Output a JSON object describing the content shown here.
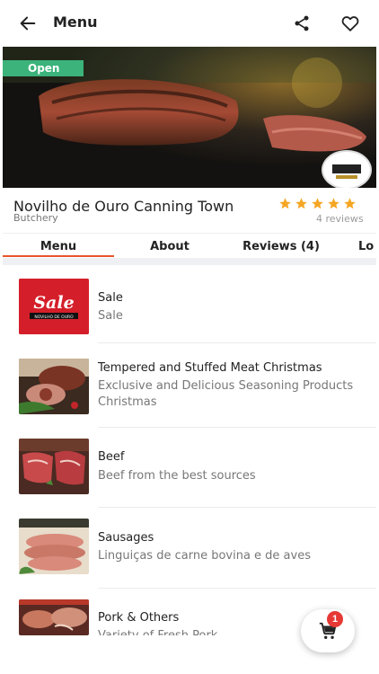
{
  "header": {
    "title": "Menu",
    "back_icon": "arrow-left-icon",
    "share_icon": "share-icon",
    "favorite_icon": "heart-outline-icon"
  },
  "hero": {
    "status_badge": "Open",
    "status_color": "#3bb37a"
  },
  "store": {
    "name": "Novilho de Ouro Canning Town",
    "category": "Butchery",
    "rating": 5,
    "reviews_label": "4 reviews",
    "star_color": "#f5a623"
  },
  "tabs": [
    {
      "label": "Menu",
      "active": true
    },
    {
      "label": "About",
      "active": false
    },
    {
      "label": "Reviews (4)",
      "active": false
    },
    {
      "label": "Lo",
      "active": false
    }
  ],
  "accent_color": "#e8542a",
  "menu_items": [
    {
      "title": "Sale",
      "description": "Sale"
    },
    {
      "title": "Tempered and Stuffed Meat Christmas",
      "description": "Exclusive and Delicious Seasoning Products Christmas"
    },
    {
      "title": "Beef",
      "description": "Beef from the best sources"
    },
    {
      "title": "Sausages",
      "description": "Linguiças de carne bovina e de aves"
    },
    {
      "title": "Pork & Others",
      "description": "Variety of Fresh Pork"
    }
  ],
  "sale_thumb": {
    "word": "Sale",
    "sub": "NOVILHO DE OURO"
  },
  "cart": {
    "count": "1",
    "icon": "cart-icon"
  }
}
